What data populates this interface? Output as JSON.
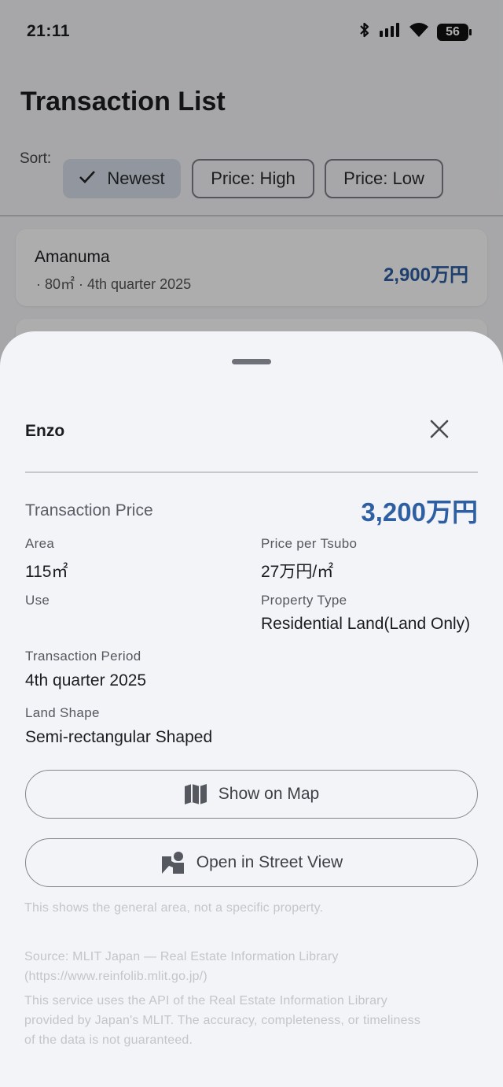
{
  "status_bar": {
    "time": "21:11",
    "battery": "56"
  },
  "screen": {
    "title": "Transaction List",
    "sort_label": "Sort:",
    "sort_options": [
      "Newest",
      "Price: High",
      "Price: Low"
    ],
    "selected_sort": "Newest",
    "list": [
      {
        "name": "Amanuma",
        "meta": "· 80㎡ · 4th quarter 2025",
        "price": "2,900万円"
      }
    ]
  },
  "sheet": {
    "title": "Enzo",
    "transaction_price_label": "Transaction Price",
    "transaction_price_value": "3,200万円",
    "fields": {
      "area_label": "Area",
      "area_value": "115㎡",
      "price_per_tsubo_label": "Price per Tsubo",
      "price_per_tsubo_value": "27万円/㎡",
      "use_label": "Use",
      "use_value": "",
      "property_type_label": "Property Type",
      "property_type_value": "Residential Land(Land Only)",
      "transaction_period_label": "Transaction Period",
      "transaction_period_value": "4th quarter 2025",
      "land_shape_label": "Land Shape",
      "land_shape_value": "Semi-rectangular Shaped"
    },
    "buttons": {
      "show_on_map": "Show on Map",
      "open_street_view": "Open in Street View"
    },
    "general_area_note": "This shows the general area, not a specific property.",
    "source_line1": "Source: MLIT Japan — Real Estate Information Library",
    "source_line2": "(https://www.reinfolib.mlit.go.jp/)",
    "disclaimer_line1": "This service uses the API of the Real Estate Information Library",
    "disclaimer_line2": "provided by Japan's MLIT. The accuracy, completeness, or timeliness",
    "disclaimer_line3": "of the data is not guaranteed."
  },
  "colors": {
    "accent": "#2f5fa3",
    "sheet_bg": "#f3f4f7",
    "chip_selected": "#d8deea"
  },
  "icons": [
    "bluetooth-icon",
    "signal-icon",
    "wifi-icon",
    "battery-icon",
    "check-icon",
    "close-icon",
    "map-icon",
    "street-view-icon"
  ]
}
